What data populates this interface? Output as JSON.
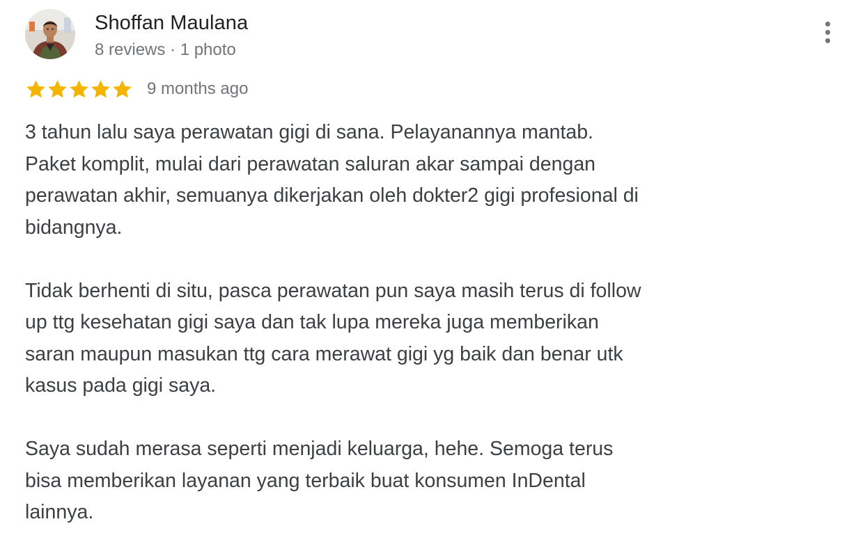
{
  "reviewer": {
    "name": "Shoffan Maulana",
    "meta": "8 reviews · 1 photo",
    "avatar_icon": "user-photo-avatar"
  },
  "menu": {
    "icon": "more-vert-icon"
  },
  "rating": {
    "stars": 5,
    "max_stars": 5,
    "star_color": "#f4b400",
    "time": "9 months ago"
  },
  "review": {
    "paragraphs": [
      "3 tahun lalu saya perawatan gigi di sana. Pelayanannya mantab.\nPaket komplit, mulai dari perawatan saluran akar sampai dengan\nperawatan akhir, semuanya dikerjakan oleh dokter2 gigi profesional di\nbidangnya.",
      "Tidak berhenti di situ, pasca perawatan pun saya masih terus di follow\nup ttg kesehatan gigi saya dan tak lupa mereka juga memberikan\nsaran maupun masukan ttg cara merawat gigi yg baik dan benar utk\nkasus pada gigi saya.",
      "Saya sudah merasa seperti menjadi keluarga, hehe. Semoga terus\nbisa memberikan layanan yang terbaik buat konsumen InDental\nlainnya."
    ]
  },
  "colors": {
    "name": "#202124",
    "secondary": "#70757a",
    "body_text": "#3c4043",
    "star": "#f4b400"
  }
}
